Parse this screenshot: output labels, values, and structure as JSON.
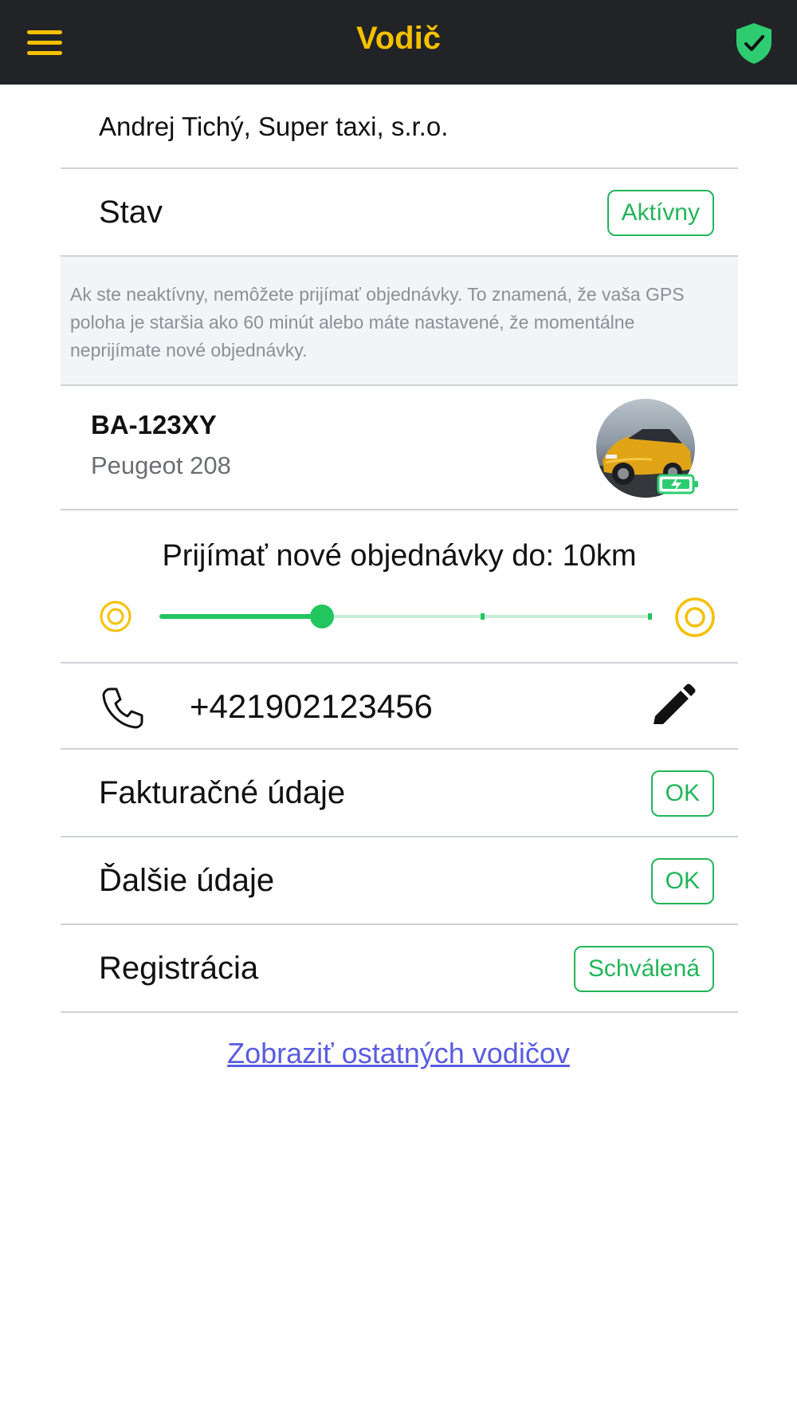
{
  "header": {
    "title": "Vodič",
    "menu_icon": "hamburger-menu-icon",
    "status_icon": "shield-check-icon",
    "accent_color": "#f5c000",
    "status_color": "#2ecc71"
  },
  "driver": {
    "company_line": "Andrej Tichý, Super taxi, s.r.o."
  },
  "status": {
    "label": "Stav",
    "badge": "Aktívny",
    "notice": "Ak ste neaktívny, nemôžete prijímať objednávky. To znamená, že vaša GPS poloha je staršia ako 60 minút alebo máte nastavené, že momentálne neprijímate nové objednávky."
  },
  "vehicle": {
    "plate": "BA-123XY",
    "model": "Peugeot 208",
    "photo_icon": "car-photo",
    "badge_icon": "battery-charging-icon"
  },
  "range": {
    "label": "Prijímať nové objednávky do: 10km",
    "slider_fraction": 0.33,
    "tick_fractions": [
      0.66,
      1.0
    ],
    "min_icon": "target-small-icon",
    "max_icon": "target-large-icon"
  },
  "phone": {
    "number": "+421902123456",
    "phone_icon": "phone-icon",
    "edit_icon": "pencil-icon"
  },
  "rows": [
    {
      "label": "Fakturačné údaje",
      "badge": "OK"
    },
    {
      "label": "Ďalšie údaje",
      "badge": "OK"
    },
    {
      "label": "Registrácia",
      "badge": "Schválená"
    }
  ],
  "footer": {
    "link": "Zobraziť ostatných vodičov"
  }
}
